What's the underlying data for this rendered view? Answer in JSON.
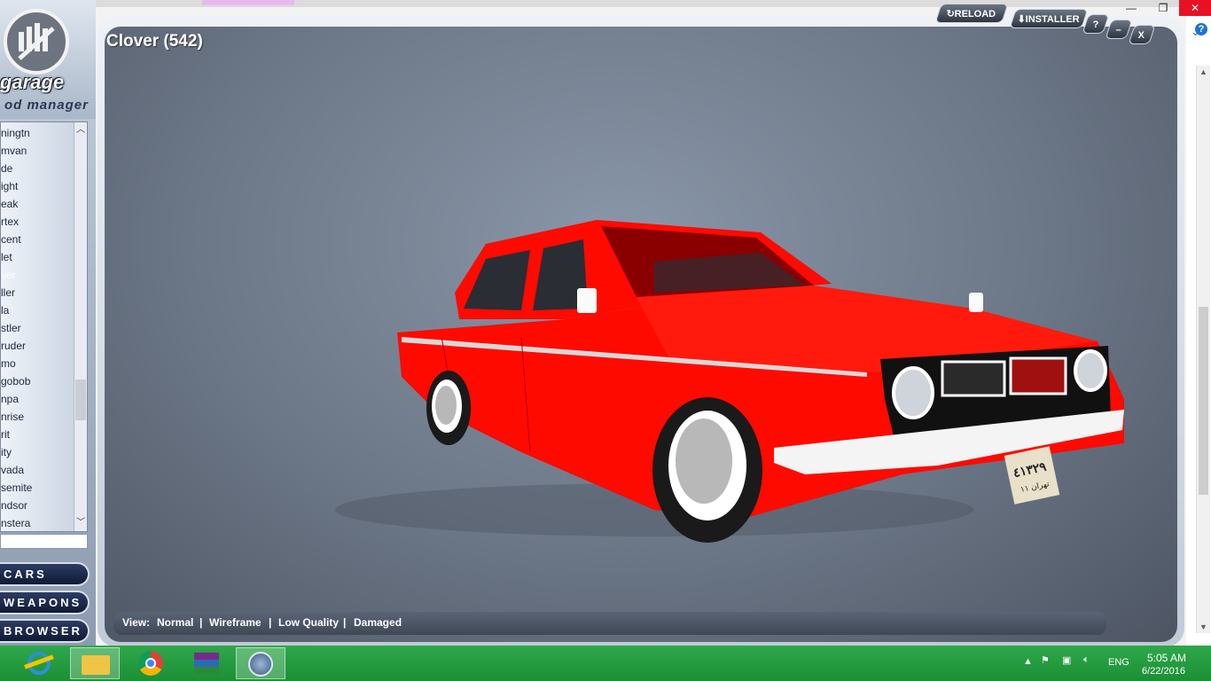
{
  "window": {
    "title": "Clover (542)"
  },
  "toolbar": {
    "reload_label": "RELOAD",
    "installer_label": "INSTALLER",
    "help_label": "?",
    "minimize_label": "–",
    "close_label": "X"
  },
  "browser_controls": {
    "restore_label": "❐",
    "close_label": "✕",
    "help_label": "?"
  },
  "logo": {
    "line1": "garage",
    "line2": "od manager"
  },
  "car_list": {
    "items": [
      "ningtn",
      "mvan",
      "de",
      "ight",
      "eak",
      "rtex",
      "cent",
      "let",
      "ver",
      "ller",
      "la",
      "stler",
      "ruder",
      "mo",
      "gobob",
      "npa",
      "nrise",
      "rit",
      "ity",
      "vada",
      "semite",
      "ndsor",
      "nstera"
    ],
    "selected_index": 8
  },
  "nav": {
    "cars_label": "CARS",
    "weapons_label": "WEAPONS",
    "browser_label": "BROWSER"
  },
  "viewbar": {
    "view_label": "View:",
    "normal_label": "Normal",
    "wireframe_label": "Wireframe",
    "lowquality_label": "Low Quality",
    "damaged_label": "Damaged",
    "sep": "|"
  },
  "car": {
    "plate_text": "٤١٣٢٩",
    "plate_sub": "تهران ١١",
    "body_color": "#ff0a00"
  },
  "taskbar": {
    "lang": "ENG",
    "time": "5:05 AM",
    "date": "6/22/2016",
    "icons": [
      "ie-icon",
      "file-explorer-icon",
      "chrome-icon",
      "winrar-icon",
      "modgarage-icon"
    ]
  },
  "colors": {
    "taskbar": "#1f9a3c",
    "accent": "#2d3c62"
  }
}
